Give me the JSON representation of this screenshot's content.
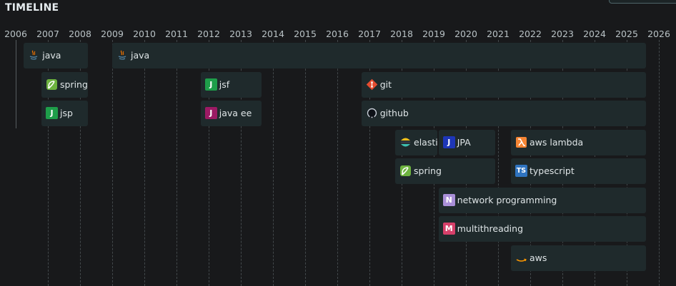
{
  "title": "TIMELINE",
  "years": [
    "2006",
    "2007",
    "2008",
    "2009",
    "2010",
    "2011",
    "2012",
    "2013",
    "2014",
    "2015",
    "2016",
    "2017",
    "2018",
    "2019",
    "2020",
    "2021",
    "2022",
    "2023",
    "2024",
    "2025",
    "2026"
  ],
  "rows": [
    {
      "label": "java",
      "icon": "java-icon",
      "start": 2006.25,
      "end": 2008.25,
      "row": 0
    },
    {
      "label": "java",
      "icon": "java-icon",
      "start": 2009.0,
      "end": 2025.6,
      "row": 0
    },
    {
      "label": "spring",
      "icon": "spring-icon",
      "color": "#6db33f",
      "start": 2006.8,
      "end": 2008.25,
      "row": 1
    },
    {
      "label": "jsf",
      "icon": "jsf-icon",
      "letter": "J",
      "color": "#1e9e4a",
      "start": 2011.75,
      "end": 2013.65,
      "row": 1
    },
    {
      "label": "git",
      "icon": "git-icon",
      "color": "#e44c30",
      "start": 2016.75,
      "end": 2025.6,
      "row": 1
    },
    {
      "label": "jsp",
      "icon": "jsp-icon",
      "letter": "J",
      "color": "#1e9e4a",
      "start": 2006.8,
      "end": 2008.25,
      "row": 2
    },
    {
      "label": "java ee",
      "icon": "java-ee-icon",
      "letter": "J",
      "color": "#9b1a64",
      "start": 2011.75,
      "end": 2013.65,
      "row": 2
    },
    {
      "label": "github",
      "icon": "github-icon",
      "start": 2016.75,
      "end": 2025.6,
      "row": 2
    },
    {
      "label": "elasticsearch",
      "icon": "elasticsearch-icon",
      "start": 2017.8,
      "end": 2019.1,
      "row": 3
    },
    {
      "label": "JPA",
      "icon": "jpa-icon",
      "letter": "J",
      "color": "#1d36b8",
      "start": 2019.15,
      "end": 2020.9,
      "row": 3
    },
    {
      "label": "aws lambda",
      "icon": "aws-lambda-icon",
      "color": "#f58534",
      "start": 2021.4,
      "end": 2025.6,
      "row": 3
    },
    {
      "label": "spring",
      "icon": "spring-icon",
      "color": "#6db33f",
      "start": 2017.8,
      "end": 2020.9,
      "row": 4
    },
    {
      "label": "typescript",
      "icon": "typescript-icon",
      "letter": "TS",
      "color": "#2f74c0",
      "start": 2021.4,
      "end": 2025.6,
      "row": 4
    },
    {
      "label": "network programming",
      "icon": "network-programming-icon",
      "letter": "N",
      "color": "#a98fd8",
      "start": 2019.15,
      "end": 2025.6,
      "row": 5
    },
    {
      "label": "multithreading",
      "icon": "multithreading-icon",
      "letter": "M",
      "color": "#d6406a",
      "start": 2019.15,
      "end": 2025.6,
      "row": 6
    },
    {
      "label": "aws",
      "icon": "aws-icon",
      "color": "#ff9900",
      "start": 2021.4,
      "end": 2025.6,
      "row": 7
    }
  ]
}
